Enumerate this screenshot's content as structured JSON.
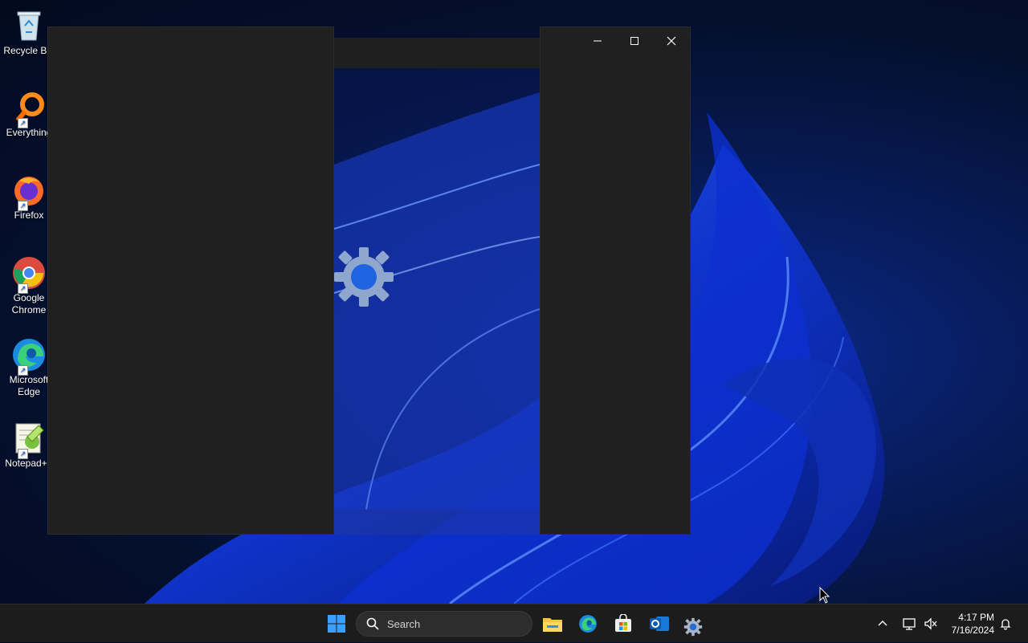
{
  "desktop": {
    "icons": [
      {
        "label": "Recycle Bin",
        "icon": "recycle-bin-icon"
      },
      {
        "label": "Everything",
        "icon": "everything-search-icon"
      },
      {
        "label": "Firefox",
        "icon": "firefox-icon"
      },
      {
        "label": "Google Chrome",
        "icon": "chrome-icon"
      },
      {
        "label": "Microsoft Edge",
        "icon": "edge-icon"
      },
      {
        "label": "Notepad++",
        "icon": "notepadpp-icon"
      }
    ]
  },
  "window": {
    "controls": {
      "minimize": "—",
      "maximize": "☐",
      "close": "✕"
    }
  },
  "taskbar": {
    "search_label": "Search",
    "apps": [
      "start-icon",
      "file-explorer-icon",
      "edge-icon",
      "store-icon",
      "outlook-icon",
      "settings-icon"
    ],
    "clock": {
      "time": "4:17 PM",
      "date": "7/16/2024"
    }
  },
  "colors": {
    "accent": "#1a5fd0",
    "taskbar": "#1c1c1c",
    "window": "#202020"
  }
}
